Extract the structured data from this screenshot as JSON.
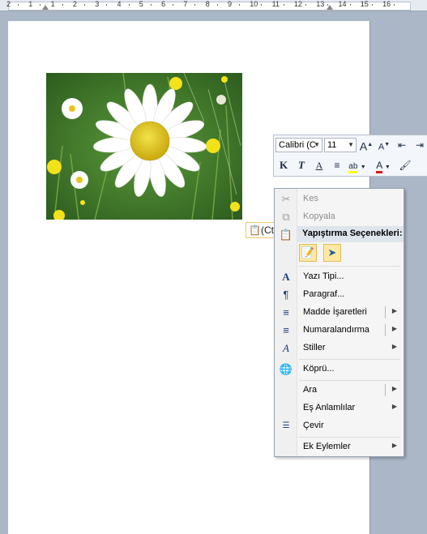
{
  "ruler": {
    "numbers": [
      "2",
      "1",
      "1",
      "2",
      "3",
      "4",
      "5",
      "6",
      "7",
      "8",
      "9",
      "10",
      "11",
      "12",
      "13",
      "14",
      "15",
      "16"
    ]
  },
  "document": {
    "picture_alt": "daisy-in-grass-photo",
    "paste_tag_label": "(Ct"
  },
  "mini_toolbar": {
    "font_name": "Calibri (C",
    "font_size": "11",
    "grow_font_label": "A",
    "shrink_font_label": "A",
    "bold_label": "K",
    "italic_label": "T",
    "highlight_label": "ab",
    "font_color_label": "A"
  },
  "context_menu": {
    "cut": "Kes",
    "copy": "Kopyala",
    "paste_options_header": "Yapıştırma Seçenekleri:",
    "font": "Yazı Tipi...",
    "paragraph": "Paragraf...",
    "bullets": "Madde İşaretleri",
    "numbering": "Numaralandırma",
    "styles": "Stiller",
    "hyperlink": "Köprü...",
    "lookup": "Ara",
    "synonyms": "Eş Anlamlılar",
    "translate": "Çevir",
    "additional_actions": "Ek Eylemler"
  },
  "colors": {
    "highlight_yellow": "#ffff00",
    "font_color_red": "#e01818",
    "menu_header_bg": "#dfe5ec"
  }
}
